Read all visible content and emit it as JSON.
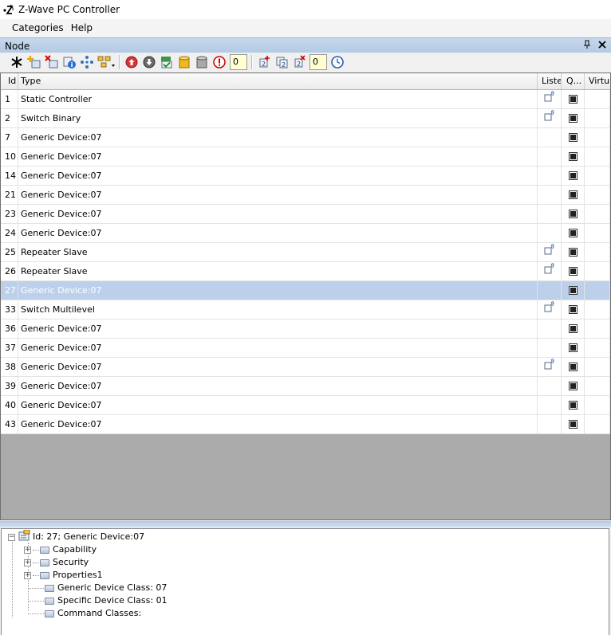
{
  "window": {
    "title": "Z-Wave PC Controller",
    "icon": "zwave-logo-icon"
  },
  "menu": {
    "items": [
      "Categories",
      "Help"
    ]
  },
  "panel": {
    "title": "Node",
    "pin_icon": "pin-icon",
    "close_icon": "close-icon"
  },
  "toolbar": {
    "counter1": "0",
    "counter2": "0"
  },
  "grid": {
    "columns": [
      "Id",
      "Type",
      "Liste",
      "Q...",
      "Virtu"
    ],
    "rows": [
      {
        "id": "1",
        "type": "Static Controller",
        "listening": true,
        "q": true
      },
      {
        "id": "2",
        "type": "Switch Binary",
        "listening": true,
        "q": true
      },
      {
        "id": "7",
        "type": "Generic Device:07",
        "listening": false,
        "q": true
      },
      {
        "id": "10",
        "type": "Generic Device:07",
        "listening": false,
        "q": true
      },
      {
        "id": "14",
        "type": "Generic Device:07",
        "listening": false,
        "q": true
      },
      {
        "id": "21",
        "type": "Generic Device:07",
        "listening": false,
        "q": true
      },
      {
        "id": "23",
        "type": "Generic Device:07",
        "listening": false,
        "q": true
      },
      {
        "id": "24",
        "type": "Generic Device:07",
        "listening": false,
        "q": true
      },
      {
        "id": "25",
        "type": "Repeater Slave",
        "listening": true,
        "q": true
      },
      {
        "id": "26",
        "type": "Repeater Slave",
        "listening": true,
        "q": true
      },
      {
        "id": "27",
        "type": "Generic Device:07",
        "listening": false,
        "q": true,
        "selected": true
      },
      {
        "id": "33",
        "type": "Switch Multilevel",
        "listening": true,
        "q": true
      },
      {
        "id": "36",
        "type": "Generic Device:07",
        "listening": false,
        "q": true
      },
      {
        "id": "37",
        "type": "Generic Device:07",
        "listening": false,
        "q": true
      },
      {
        "id": "38",
        "type": "Generic Device:07",
        "listening": true,
        "q": true
      },
      {
        "id": "39",
        "type": "Generic Device:07",
        "listening": false,
        "q": true
      },
      {
        "id": "40",
        "type": "Generic Device:07",
        "listening": false,
        "q": true
      },
      {
        "id": "43",
        "type": "Generic Device:07",
        "listening": false,
        "q": true
      }
    ]
  },
  "tree": {
    "root": "Id: 27; Generic Device:07",
    "children": [
      {
        "label": "Capability",
        "expandable": true
      },
      {
        "label": "Security",
        "expandable": true
      },
      {
        "label": "Properties1",
        "expandable": true
      },
      {
        "label": "Generic Device Class: 07",
        "expandable": false
      },
      {
        "label": "Specific Device Class: 01",
        "expandable": false
      },
      {
        "label": "Command Classes:",
        "expandable": false
      }
    ]
  },
  "colors": {
    "selection": "#bcd0eb",
    "panel_header": "#b2c9e4",
    "grid_bg": "#ababab",
    "counter_bg": "#ffffd2"
  }
}
